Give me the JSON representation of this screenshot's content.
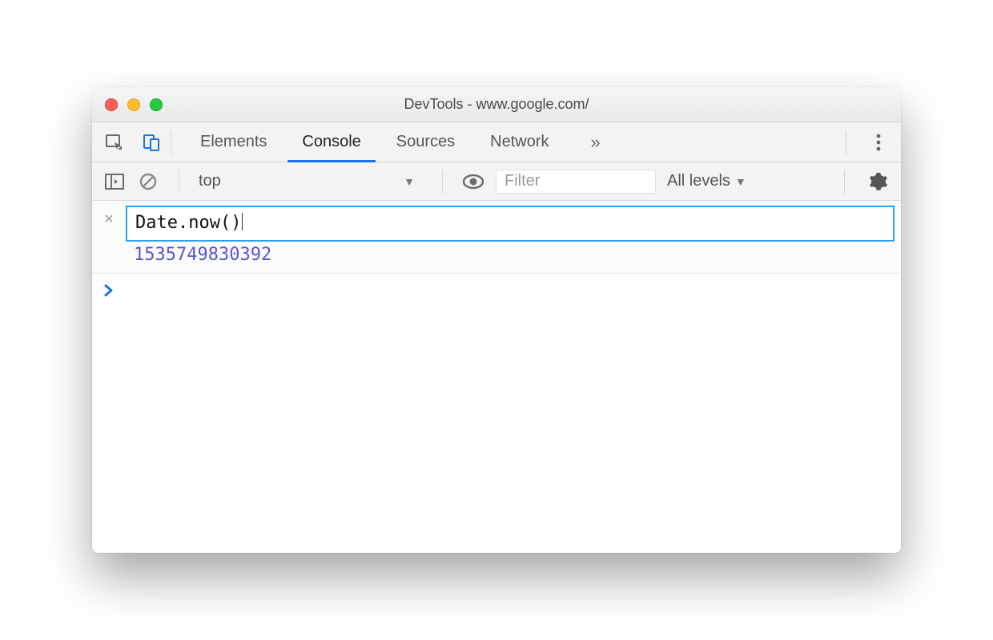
{
  "window": {
    "title": "DevTools - www.google.com/"
  },
  "tabs": {
    "items": [
      "Elements",
      "Console",
      "Sources",
      "Network"
    ],
    "active_index": 1,
    "overflow_glyph": "»"
  },
  "toolbar": {
    "context_label": "top",
    "filter_placeholder": "Filter",
    "levels_label": "All levels"
  },
  "console": {
    "expression": "Date.now()",
    "result": "1535749830392",
    "prompt_glyph": "›",
    "close_glyph": "×"
  },
  "icons": {
    "inspect": "inspect-icon",
    "device": "device-icon",
    "play": "play-panel-icon",
    "clear": "clear-icon",
    "eye": "live-expression-icon",
    "gear": "settings-icon",
    "kebab": "more-icon"
  }
}
